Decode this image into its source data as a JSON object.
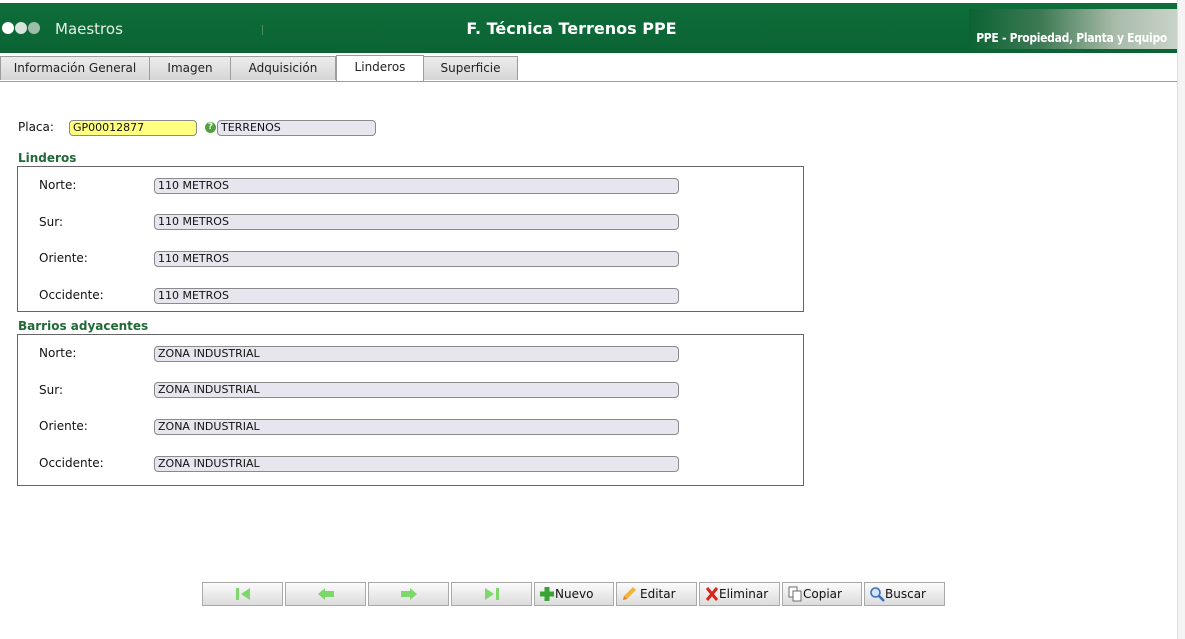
{
  "header": {
    "app_name": "Maestros",
    "title": "F. Técnica Terrenos PPE",
    "module": "PPE - Propiedad, Planta y Equipo",
    "colors": {
      "header_bg": "#0b6333",
      "section_title": "#1f6a36",
      "placa_bg": "#ffff80"
    }
  },
  "tabs": [
    {
      "label": "Información General",
      "active": false
    },
    {
      "label": "Imagen",
      "active": false
    },
    {
      "label": "Adquisición",
      "active": false
    },
    {
      "label": "Linderos",
      "active": true
    },
    {
      "label": "Superficie",
      "active": false
    }
  ],
  "form": {
    "placa_label": "Placa:",
    "placa_value": "GP00012877",
    "placa_desc": "TERRENOS",
    "help_icon": "question-icon"
  },
  "linderos": {
    "title": "Linderos",
    "rows": [
      {
        "label": "Norte:",
        "value": "110 METROS"
      },
      {
        "label": "Sur:",
        "value": "110 METROS"
      },
      {
        "label": "Oriente:",
        "value": "110 METROS"
      },
      {
        "label": "Occidente:",
        "value": "110 METROS"
      }
    ]
  },
  "barrios": {
    "title": "Barrios adyacentes",
    "rows": [
      {
        "label": "Norte:",
        "value": "ZONA INDUSTRIAL"
      },
      {
        "label": "Sur:",
        "value": "ZONA INDUSTRIAL"
      },
      {
        "label": "Oriente:",
        "value": "ZONA INDUSTRIAL"
      },
      {
        "label": "Occidente:",
        "value": "ZONA INDUSTRIAL"
      }
    ]
  },
  "toolbar": {
    "first_icon": "first-record-icon",
    "prev_icon": "previous-arrow-icon",
    "next_icon": "next-arrow-icon",
    "last_icon": "last-record-icon",
    "nuevo": "Nuevo",
    "editar": "Editar",
    "eliminar": "Eliminar",
    "copiar": "Copiar",
    "buscar": "Buscar"
  }
}
